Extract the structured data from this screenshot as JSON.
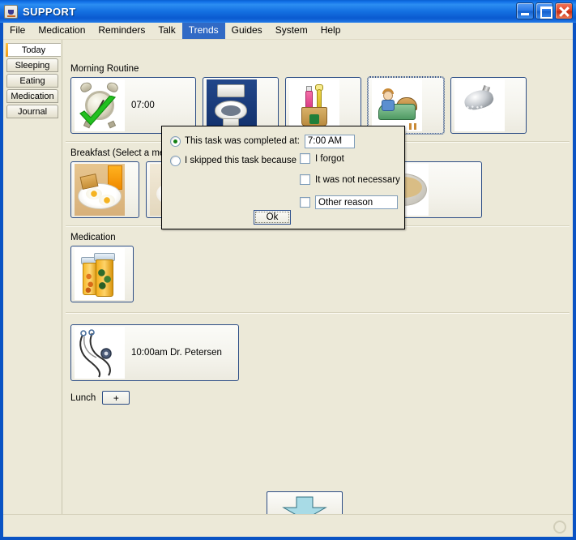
{
  "window": {
    "title": "SUPPORT",
    "icon": "java-cup-icon",
    "buttons": {
      "minimize": "minimize-button",
      "maximize": "maximize-button",
      "close": "close-button"
    }
  },
  "menubar": {
    "items": [
      {
        "label": "File",
        "selected": false
      },
      {
        "label": "Medication",
        "selected": false
      },
      {
        "label": "Reminders",
        "selected": false
      },
      {
        "label": "Talk",
        "selected": false
      },
      {
        "label": "Trends",
        "selected": true
      },
      {
        "label": "Guides",
        "selected": false
      },
      {
        "label": "System",
        "selected": false
      },
      {
        "label": "Help",
        "selected": false
      }
    ],
    "selected_accent": "#316ac5"
  },
  "sidebar": {
    "items": [
      {
        "label": "Today",
        "active": true
      },
      {
        "label": "Sleeping",
        "active": false
      },
      {
        "label": "Eating",
        "active": false
      },
      {
        "label": "Medication",
        "active": false
      },
      {
        "label": "Journal",
        "active": false
      }
    ],
    "active_accent": "#ef9a16"
  },
  "sections": {
    "morning": {
      "label": "Morning Routine",
      "tiles": [
        {
          "icon": "alarm-clock-icon",
          "text": "07:00",
          "completed": true,
          "focused": false
        },
        {
          "icon": "toilet-icon",
          "text": "",
          "completed": false,
          "focused": false
        },
        {
          "icon": "toothbrush-cup-icon",
          "text": "",
          "completed": false,
          "focused": false
        },
        {
          "icon": "make-bed-icon",
          "text": "",
          "completed": false,
          "focused": true
        },
        {
          "icon": "shower-head-icon",
          "text": "",
          "completed": false,
          "focused": false
        }
      ]
    },
    "breakfast": {
      "label": "Breakfast (Select a meal)",
      "tiles": [
        {
          "icon": "eggs-toast-plate-icon",
          "text": ""
        },
        {
          "icon": "orange-juice-meal-icon",
          "text": ""
        },
        {
          "icon": "vegetable-meal-icon",
          "text": ""
        },
        {
          "icon": "oatmeal-bowl-icon",
          "text": ""
        }
      ]
    },
    "medication": {
      "label": "Medication",
      "tiles": [
        {
          "icon": "pill-bottles-icon",
          "text": ""
        }
      ]
    },
    "appointment": {
      "label": "",
      "tiles": [
        {
          "icon": "stethoscope-icon",
          "text": "10:00am Dr. Petersen"
        }
      ]
    },
    "lunch": {
      "label": "Lunch",
      "add_label": "+"
    }
  },
  "next_button": {
    "name": "next-arrow-button",
    "icon": "down-arrow-icon",
    "fill_color": "#a8dbe6"
  },
  "dialog": {
    "radios": [
      {
        "label": "This task was completed at:",
        "checked": true
      },
      {
        "label": "I skipped this task because",
        "checked": false
      }
    ],
    "time_value": "7:00 AM",
    "checkboxes": [
      {
        "label": "I forgot",
        "checked": false
      },
      {
        "label": "It was not necessary",
        "checked": false
      },
      {
        "label": "",
        "checked": false
      }
    ],
    "other_reason_value": "Other reason",
    "ok_label": "Ok"
  },
  "statusbar": {
    "badge": "spinner-idle-icon"
  }
}
